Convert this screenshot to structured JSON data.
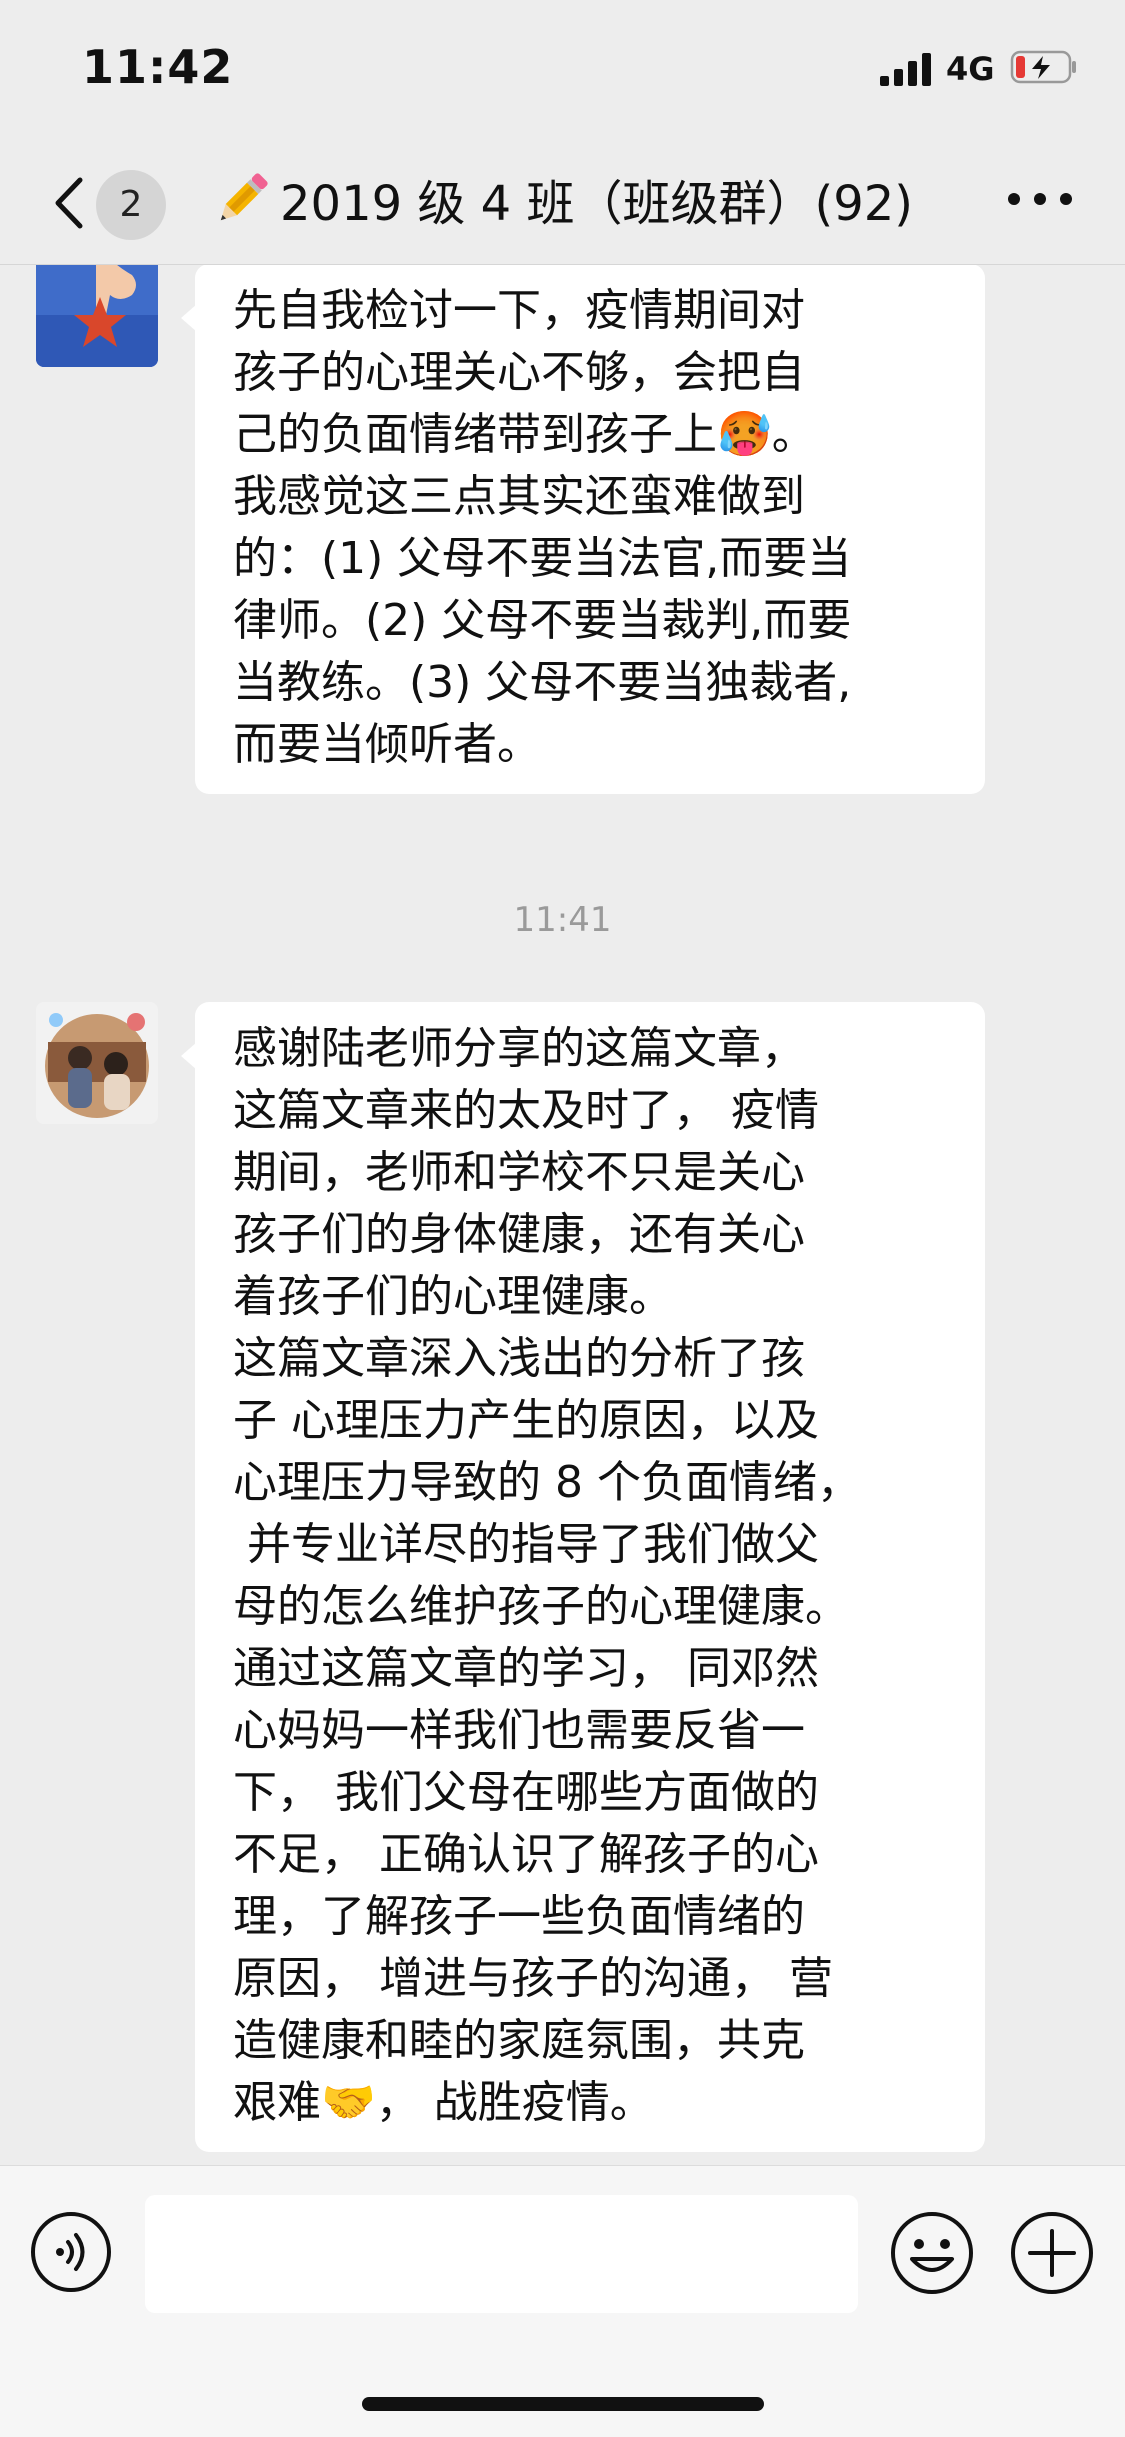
{
  "status_bar": {
    "time": "11:42",
    "network": "4G"
  },
  "nav": {
    "unread_count": "2",
    "title": "2019 级 4 班（班级群）(92)",
    "title_icon": "pencil-icon"
  },
  "messages": [
    {
      "avatar_icon": "starfish-photo-avatar",
      "text": "先自我检讨一下，疫情期间对\n孩子的心理关心不够，会把自\n己的负面情绪带到孩子上🥵。\n我感觉这三点其实还蛮难做到\n的：(1) 父母不要当法官,而要当\n律师。(2) 父母不要当裁判,而要\n当教练。(3) 父母不要当独裁者,\n而要当倾听者。"
    },
    {
      "timestamp": "11:41",
      "avatar_icon": "family-photo-avatar",
      "text": "感谢陆老师分享的这篇文章，\n这篇文章来的太及时了， 疫情\n期间，老师和学校不只是关心\n孩子们的身体健康，还有关心\n着孩子们的心理健康。\n这篇文章深入浅出的分析了孩\n子 心理压力产生的原因，以及\n心理压力导致的 8 个负面情绪，\n 并专业详尽的指导了我们做父\n母的怎么维护孩子的心理健康。\n通过这篇文章的学习， 同邓然\n心妈妈一样我们也需要反省一\n下， 我们父母在哪些方面做的\n不足， 正确认识了解孩子的心\n理，了解孩子一些负面情绪的\n原因， 增进与孩子的沟通， 营\n造健康和睦的家庭氛围，共克\n艰难🤝， 战胜疫情。"
    }
  ],
  "input_bar": {
    "voice_icon": "voice-icon",
    "emoji_icon": "emoji-icon",
    "plus_icon": "plus-icon",
    "input_value": ""
  },
  "colors": {
    "background": "#ededed",
    "bubble": "#ffffff",
    "timestamp": "#9a9a9a",
    "battery_low": "#e53935"
  }
}
